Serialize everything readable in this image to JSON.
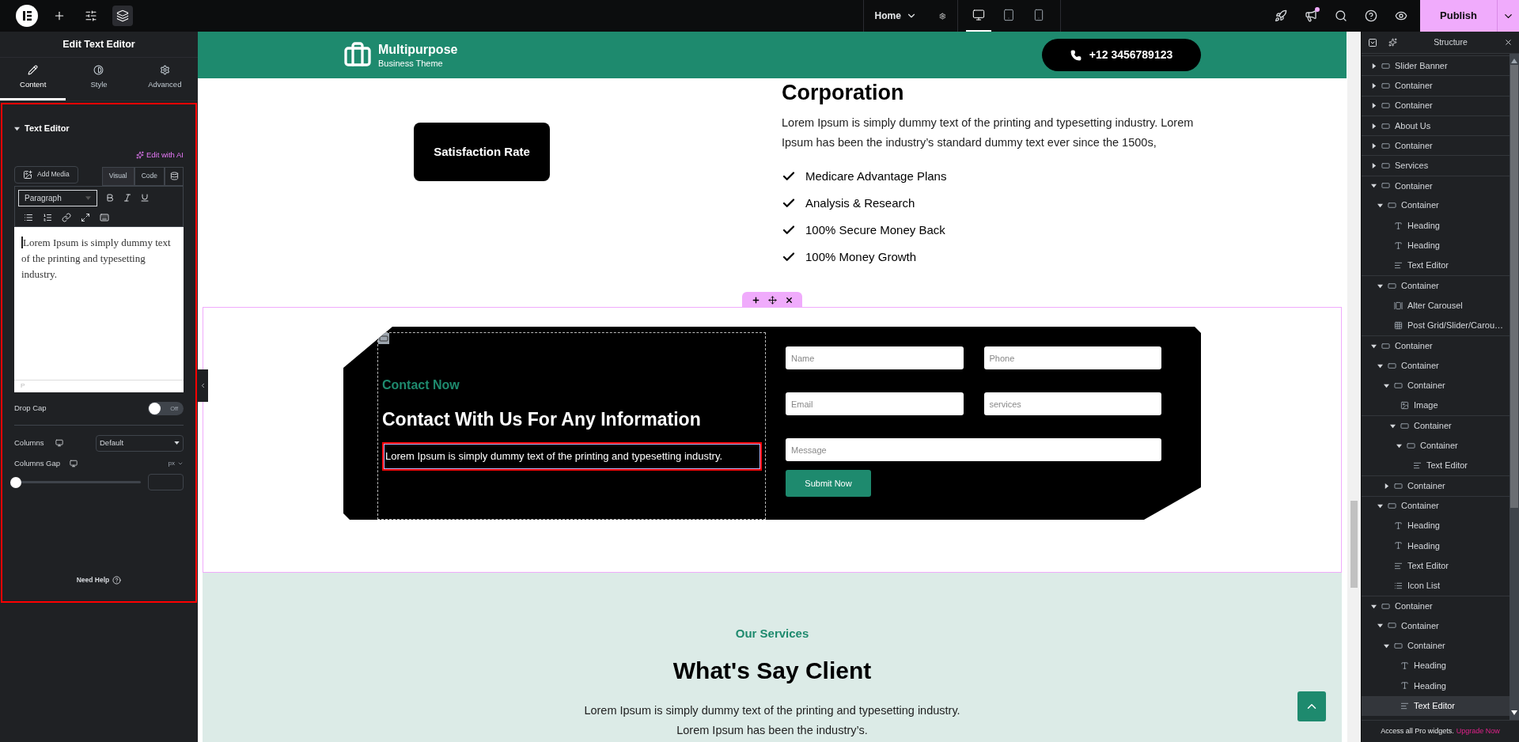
{
  "topbar": {
    "tools": [
      {
        "kind": "add",
        "selected": false
      },
      {
        "kind": "settings",
        "selected": false
      },
      {
        "kind": "structure",
        "selected": true
      }
    ],
    "page": "Home",
    "devices": [
      {
        "kind": "desktop",
        "selected": true
      },
      {
        "kind": "tablet",
        "selected": false
      },
      {
        "kind": "mobile",
        "selected": false
      }
    ],
    "has_notification": true,
    "publish": "Publish"
  },
  "panel": {
    "title": "Edit Text Editor",
    "tabs": [
      {
        "label": "Content",
        "kind": "content",
        "selected": true
      },
      {
        "label": "Style",
        "kind": "style",
        "selected": false
      },
      {
        "label": "Advanced",
        "kind": "advanced",
        "selected": false
      }
    ],
    "section": {
      "title": "Text Editor",
      "expanded": true
    },
    "edit_ai": "Edit with AI",
    "add_media": "Add Media",
    "editor_tabs": [
      {
        "label": "Visual",
        "selected": true
      },
      {
        "label": "Code",
        "selected": false
      }
    ],
    "format": "Paragraph",
    "content": "Lorem Ipsum is simply dummy text of the printing and typesetting industry.",
    "path": "P",
    "drop_cap": {
      "label": "Drop Cap",
      "on": false,
      "state_text": "Off"
    },
    "columns": {
      "label": "Columns",
      "value": "Default"
    },
    "columns_gap": {
      "label": "Columns Gap",
      "unit": "px",
      "level": 0
    },
    "help": "Need Help"
  },
  "canvas": {
    "header": {
      "brand": "Multipurpose",
      "tagline": "Business Theme",
      "phone": "+12 3456789123"
    },
    "about": {
      "badge": "Satisfaction Rate",
      "heading": "Corporation",
      "text": "Lorem Ipsum is simply dummy text of the printing and typesetting industry. Lorem Ipsum has been the industry’s standard dummy text ever since the 1500s,",
      "checklist": [
        "Medicare Advantage Plans",
        "Analysis & Research",
        "100% Secure Money Back",
        "100% Money Growth"
      ]
    },
    "contact": {
      "eyebrow": "Contact Now",
      "heading": "Contact With Us For Any Information",
      "text": "Lorem Ipsum is simply dummy text of the printing and typesetting industry.",
      "fields": [
        {
          "placeholder": "Name",
          "kind": "half"
        },
        {
          "placeholder": "Phone",
          "kind": "half"
        },
        {
          "placeholder": "Email",
          "kind": "half"
        },
        {
          "placeholder": "services",
          "kind": "half"
        },
        {
          "placeholder": "Message",
          "kind": "full"
        }
      ],
      "submit": "Submit Now"
    },
    "services": {
      "eyebrow": "Our Services",
      "heading": "What's Say Client",
      "lines": [
        "Lorem Ipsum is simply dummy text of the printing and typesetting industry.",
        "Lorem Ipsum has been the industry’s."
      ]
    }
  },
  "structure": {
    "title": "Structure",
    "tree": [
      {
        "label": "Slider Banner",
        "kind": "container",
        "expanded": false,
        "selected": false
      },
      {
        "label": "Container",
        "kind": "container",
        "expanded": false,
        "selected": false
      },
      {
        "label": "Container",
        "kind": "container",
        "expanded": false,
        "selected": false
      },
      {
        "label": "About Us",
        "kind": "container",
        "expanded": false,
        "selected": false
      },
      {
        "label": "Container",
        "kind": "container",
        "expanded": false,
        "selected": false
      },
      {
        "label": "Services",
        "kind": "container",
        "expanded": false,
        "selected": false
      },
      {
        "label": "Container",
        "kind": "container",
        "expanded": true,
        "selected": false,
        "children": [
          {
            "label": "Container",
            "kind": "container",
            "expanded": true,
            "selected": false,
            "children": [
              {
                "label": "Heading",
                "kind": "heading",
                "selected": false
              },
              {
                "label": "Heading",
                "kind": "heading",
                "selected": false
              },
              {
                "label": "Text Editor",
                "kind": "text",
                "selected": false
              }
            ]
          },
          {
            "label": "Container",
            "kind": "container",
            "expanded": true,
            "selected": false,
            "children": [
              {
                "label": "Alter Carousel",
                "kind": "carousel",
                "selected": false
              },
              {
                "label": "Post Grid/Slider/Carou…",
                "kind": "grid",
                "selected": false
              }
            ]
          }
        ]
      },
      {
        "label": "Container",
        "kind": "container",
        "expanded": true,
        "selected": false,
        "children": [
          {
            "label": "Container",
            "kind": "container",
            "expanded": true,
            "selected": false,
            "children": [
              {
                "label": "Container",
                "kind": "container",
                "expanded": true,
                "selected": false,
                "children": [
                  {
                    "label": "Image",
                    "kind": "image",
                    "selected": false
                  },
                  {
                    "label": "Container",
                    "kind": "container",
                    "expanded": true,
                    "selected": false,
                    "children": [
                      {
                        "label": "Container",
                        "kind": "container",
                        "expanded": true,
                        "selected": false,
                        "children": [
                          {
                            "label": "Text Editor",
                            "kind": "text",
                            "selected": false
                          }
                        ]
                      }
                    ]
                  }
                ]
              },
              {
                "label": "Container",
                "kind": "container",
                "expanded": false,
                "selected": false
              }
            ]
          },
          {
            "label": "Container",
            "kind": "container",
            "expanded": true,
            "selected": false,
            "children": [
              {
                "label": "Heading",
                "kind": "heading",
                "selected": false
              },
              {
                "label": "Heading",
                "kind": "heading",
                "selected": false
              },
              {
                "label": "Text Editor",
                "kind": "text",
                "selected": false
              },
              {
                "label": "Icon List",
                "kind": "list",
                "selected": false
              }
            ]
          }
        ]
      },
      {
        "label": "Container",
        "kind": "container",
        "expanded": true,
        "selected": false,
        "children": [
          {
            "label": "Container",
            "kind": "container",
            "expanded": true,
            "selected": false,
            "children": [
              {
                "label": "Container",
                "kind": "container",
                "expanded": true,
                "selected": false,
                "children": [
                  {
                    "label": "Heading",
                    "kind": "heading",
                    "selected": false
                  },
                  {
                    "label": "Heading",
                    "kind": "heading",
                    "selected": false
                  },
                  {
                    "label": "Text Editor",
                    "kind": "text",
                    "selected": true
                  }
                ]
              }
            ]
          }
        ]
      }
    ],
    "footer": "Access all Pro widgets.",
    "upgrade": "Upgrade Now"
  }
}
